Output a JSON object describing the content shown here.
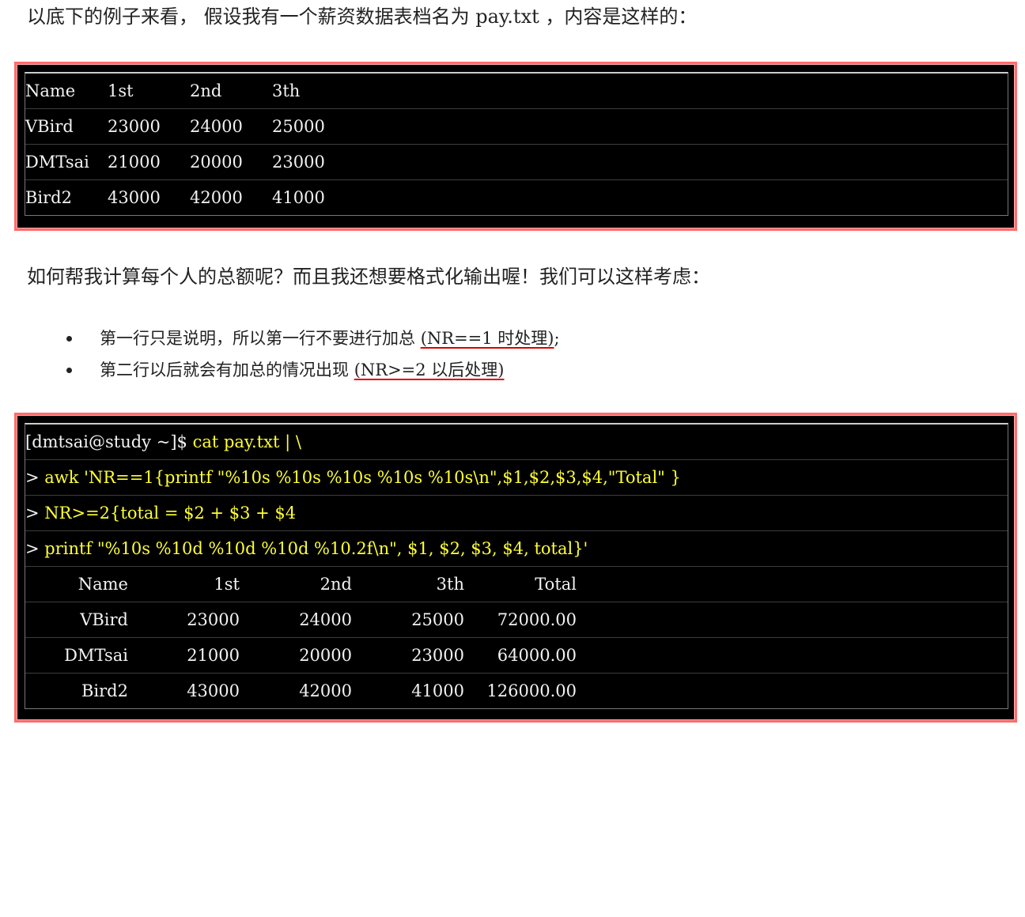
{
  "intro_text": "以底下的例子来看， 假设我有一个薪资数据表档名为 pay.txt ，内容是这样的：",
  "file_table": {
    "rows": [
      [
        "Name",
        "1st",
        "2nd",
        "3th"
      ],
      [
        "VBird",
        "23000",
        "24000",
        "25000"
      ],
      [
        "DMTsai",
        "21000",
        "20000",
        "23000"
      ],
      [
        "Bird2",
        "43000",
        "42000",
        "41000"
      ]
    ]
  },
  "question_text": "如何帮我计算每个人的总额呢？而且我还想要格式化输出喔！我们可以这样考虑：",
  "bullets": [
    {
      "text": "第一行只是说明，所以第一行不要进行加总 ",
      "link": "(NR==1 时处理)",
      "suffix": ";"
    },
    {
      "text": "第二行以后就会有加总的情况出现 ",
      "link": "(NR>=2 以后处理)",
      "suffix": ""
    }
  ],
  "terminal": {
    "prompt": "[dmtsai@study ~]$ ",
    "commands": [
      {
        "prefix": "",
        "text": "cat pay.txt | \\"
      },
      {
        "prefix": "> ",
        "text": "awk 'NR==1{printf \"%10s %10s %10s %10s %10s\\n\",$1,$2,$3,$4,\"Total\" }"
      },
      {
        "prefix": "> ",
        "text": "NR>=2{total = $2 + $3 + $4"
      },
      {
        "prefix": "> ",
        "text": "printf \"%10s %10d %10d %10d %10.2f\\n\", $1, $2, $3, $4, total}'"
      }
    ],
    "output": [
      [
        "Name",
        "1st",
        "2nd",
        "3th",
        "Total"
      ],
      [
        "VBird",
        "23000",
        "24000",
        "25000",
        "72000.00"
      ],
      [
        "DMTsai",
        "21000",
        "20000",
        "23000",
        "64000.00"
      ],
      [
        "Bird2",
        "43000",
        "42000",
        "41000",
        "126000.00"
      ]
    ]
  },
  "colors": {
    "frame": "#ff6b6b",
    "terminal_bg": "#000000",
    "command": "#ffff33",
    "output": "#f2f2f2",
    "underline": "#e00000"
  }
}
